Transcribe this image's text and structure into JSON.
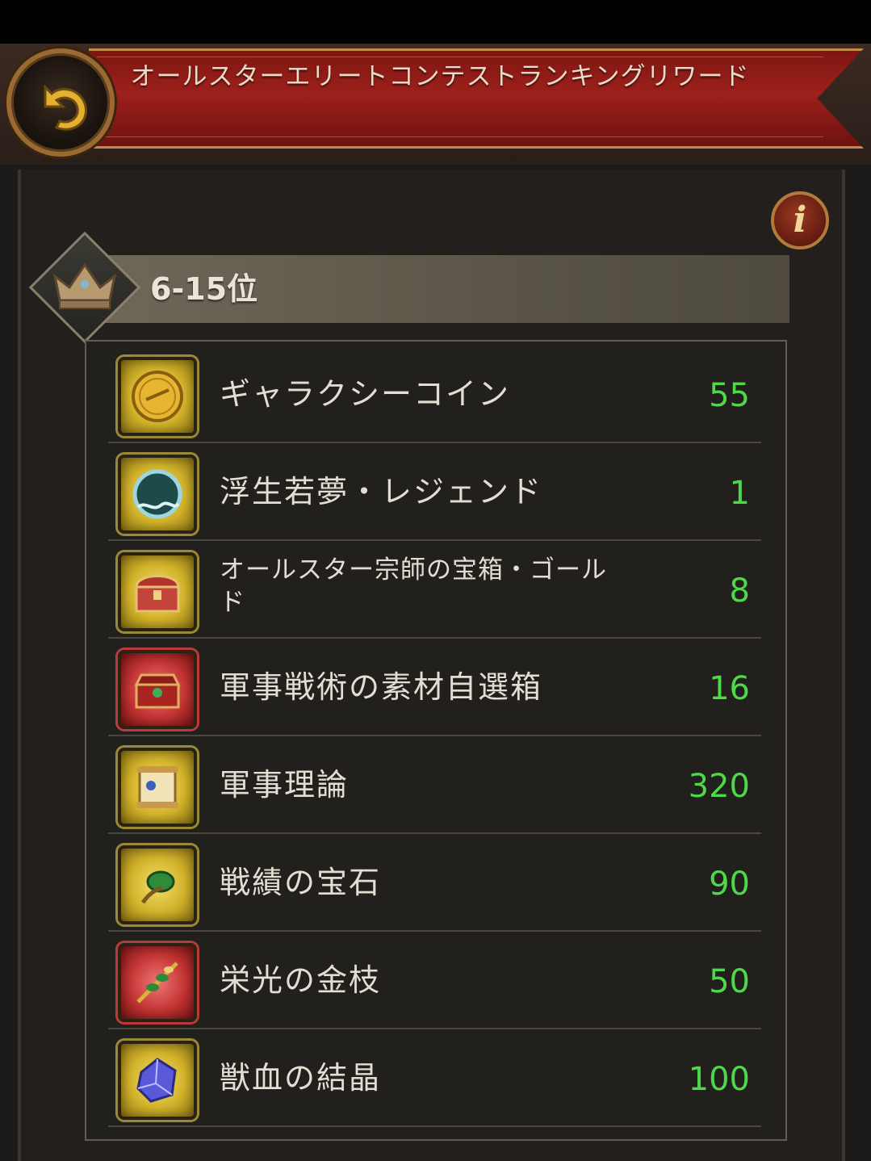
{
  "header": {
    "title": "オールスターエリートコンテストランキングリワード"
  },
  "rank": {
    "label": "6-15位"
  },
  "rewards": [
    {
      "name": "ギャラクシーコイン",
      "qty": "55",
      "frame": "gold",
      "icon": "all-star-coin-icon"
    },
    {
      "name": "浮生若夢・レジェンド",
      "qty": "1",
      "frame": "gold",
      "icon": "mirror-frame-icon"
    },
    {
      "name": "オールスター宗師の宝箱・ゴールド",
      "qty": "8",
      "frame": "gold",
      "icon": "treasure-chest-icon"
    },
    {
      "name": "軍事戦術の素材自選箱",
      "qty": "16",
      "frame": "red",
      "icon": "red-chest-icon"
    },
    {
      "name": "軍事理論",
      "qty": "320",
      "frame": "gold",
      "icon": "scroll-icon"
    },
    {
      "name": "戦績の宝石",
      "qty": "90",
      "frame": "gold",
      "icon": "green-gem-icon"
    },
    {
      "name": "栄光の金枝",
      "qty": "50",
      "frame": "red",
      "icon": "golden-branch-icon"
    },
    {
      "name": "獣血の結晶",
      "qty": "100",
      "frame": "gold",
      "icon": "crystal-icon"
    }
  ],
  "colors": {
    "banner": "#9d201b",
    "quantity": "#4ed84a",
    "frame_gold": "#9a8a38",
    "frame_red": "#b83a3a"
  }
}
